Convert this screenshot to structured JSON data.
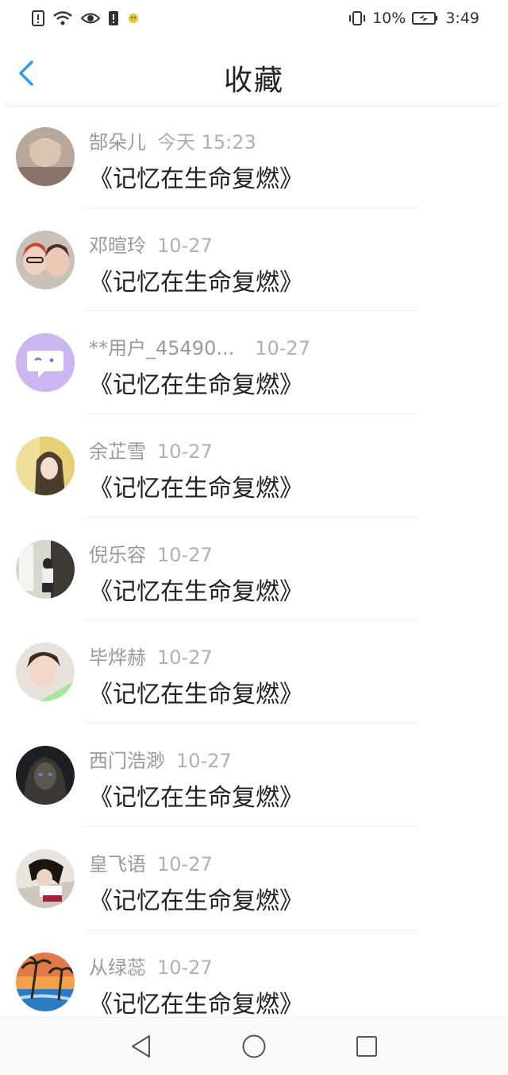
{
  "status_bar": {
    "icons_left": [
      "alert-icon",
      "wifi-icon",
      "eye-icon",
      "sim-alert-icon",
      "app-notification-icon"
    ],
    "vibrate_icon": "vibrate-icon",
    "battery_percent": "10%",
    "battery_icon": "battery-charging-icon",
    "time": "3:49"
  },
  "header": {
    "title": "收藏",
    "back_icon": "chevron-left-icon",
    "accent_color": "#2a9df4"
  },
  "favorites": [
    {
      "name": "郜朵儿",
      "time": "今天 15:23",
      "content": "《记忆在生命复燃》"
    },
    {
      "name": "邓暄玲",
      "time": "10-27",
      "content": "《记忆在生命复燃》"
    },
    {
      "name": "**用户_45490...",
      "time": "10-27",
      "content": "《记忆在生命复燃》"
    },
    {
      "name": "余芷雪",
      "time": "10-27",
      "content": "《记忆在生命复燃》"
    },
    {
      "name": "倪乐容",
      "time": "10-27",
      "content": "《记忆在生命复燃》"
    },
    {
      "name": "毕烨赫",
      "time": "10-27",
      "content": "《记忆在生命复燃》"
    },
    {
      "name": "西门浩渺",
      "time": "10-27",
      "content": "《记忆在生命复燃》"
    },
    {
      "name": "皇飞语",
      "time": "10-27",
      "content": "《记忆在生命复燃》"
    },
    {
      "name": "从绿蕊",
      "time": "10-27",
      "content": "《记忆在生命复燃》"
    }
  ],
  "system_nav": {
    "back_icon": "triangle-back-icon",
    "home_icon": "circle-home-icon",
    "recents_icon": "square-recents-icon"
  }
}
